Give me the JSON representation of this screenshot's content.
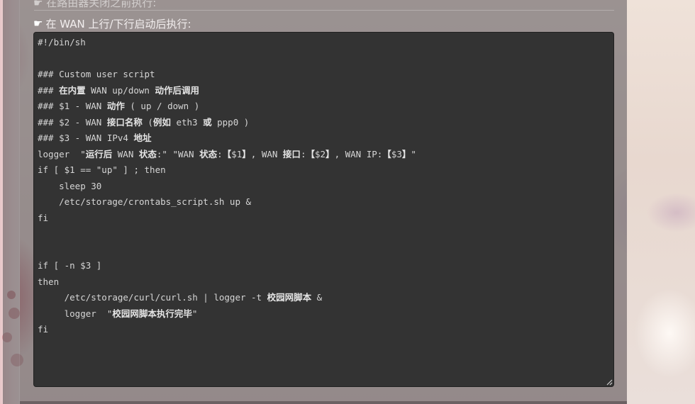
{
  "header": {
    "truncated_label": "在路由器关闭之前执行:",
    "section_label": "在 WAN 上行/下行启动后执行:",
    "section_icon": "hand-pointing-right-icon"
  },
  "editor": {
    "lines": [
      "#!/bin/sh",
      "",
      "### Custom user script",
      "### 在内置 WAN up/down 动作后调用",
      "### $1 - WAN 动作 ( up / down )",
      "### $2 - WAN 接口名称 (例如 eth3 或 ppp0 )",
      "### $3 - WAN IPv4 地址",
      "logger  \"运行后 WAN 状态:\" \"WAN 状态:【$1】, WAN 接口:【$2】, WAN IP:【$3】\"",
      "if [ $1 == \"up\" ] ; then",
      "    sleep 30",
      "    /etc/storage/crontabs_script.sh up &",
      "fi",
      "",
      "",
      "if [ -n $3 ]",
      "then",
      "     /etc/storage/curl/curl.sh | logger -t 校园网脚本 &",
      "     logger  \"校园网脚本执行完毕\"",
      "fi"
    ]
  },
  "colors": {
    "editor_bg": "#333333",
    "editor_text": "#d6d6d6",
    "panel_overlay": "#5c5458"
  }
}
